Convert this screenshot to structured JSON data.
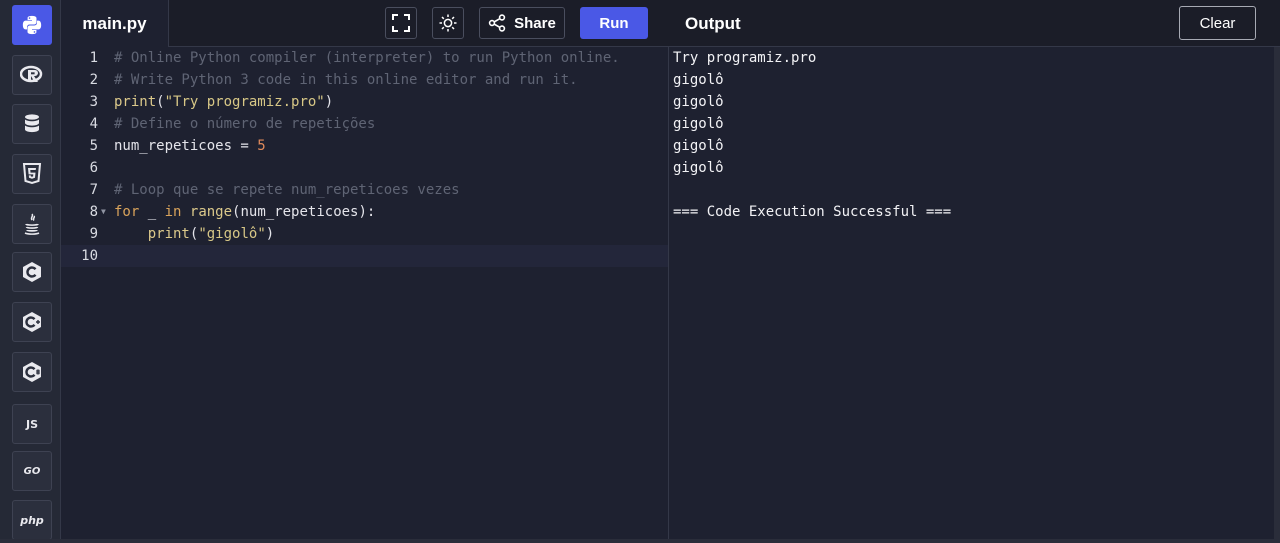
{
  "sidebar": {
    "languages": [
      {
        "name": "python",
        "label": ""
      },
      {
        "name": "r",
        "label": ""
      },
      {
        "name": "sql",
        "label": ""
      },
      {
        "name": "html",
        "label": ""
      },
      {
        "name": "java",
        "label": ""
      },
      {
        "name": "c",
        "label": ""
      },
      {
        "name": "cpp",
        "label": ""
      },
      {
        "name": "csharp",
        "label": ""
      },
      {
        "name": "javascript",
        "label": "JS"
      },
      {
        "name": "go",
        "label": "GO"
      },
      {
        "name": "php",
        "label": "php"
      }
    ],
    "active": "python"
  },
  "header": {
    "file_tab": "main.py",
    "share_label": "Share",
    "run_label": "Run",
    "output_title": "Output",
    "clear_label": "Clear"
  },
  "editor": {
    "line_numbers": [
      "1",
      "2",
      "3",
      "4",
      "5",
      "6",
      "7",
      "8",
      "9",
      "10"
    ],
    "lines": {
      "l1": "# Online Python compiler (interpreter) to run Python online.",
      "l2": "# Write Python 3 code in this online editor and run it.",
      "l3_fn": "print",
      "l3_open": "(",
      "l3_str": "\"Try programiz.pro\"",
      "l3_close": ")",
      "l4": "# Define o número de repetições",
      "l5_var": "num_repeticoes = ",
      "l5_num": "5",
      "l7": "# Loop que se repete num_repeticoes vezes",
      "l8_for": "for",
      "l8_mid": " _ ",
      "l8_in": "in",
      "l8_sp": " ",
      "l8_range": "range",
      "l8_rest": "(num_repeticoes):",
      "l9_indent": "    ",
      "l9_fn": "print",
      "l9_open": "(",
      "l9_str": "\"gigolô\"",
      "l9_close": ")"
    }
  },
  "output": {
    "lines": [
      "Try programiz.pro",
      "gigolô",
      "gigolô",
      "gigolô",
      "gigolô",
      "gigolô",
      "",
      "=== Code Execution Successful ==="
    ]
  },
  "colors": {
    "accent": "#4a58e6",
    "background": "#1e2130",
    "comment": "#5f6474",
    "keyword": "#d9a35b",
    "string": "#d7c786",
    "number": "#e08a5b"
  }
}
